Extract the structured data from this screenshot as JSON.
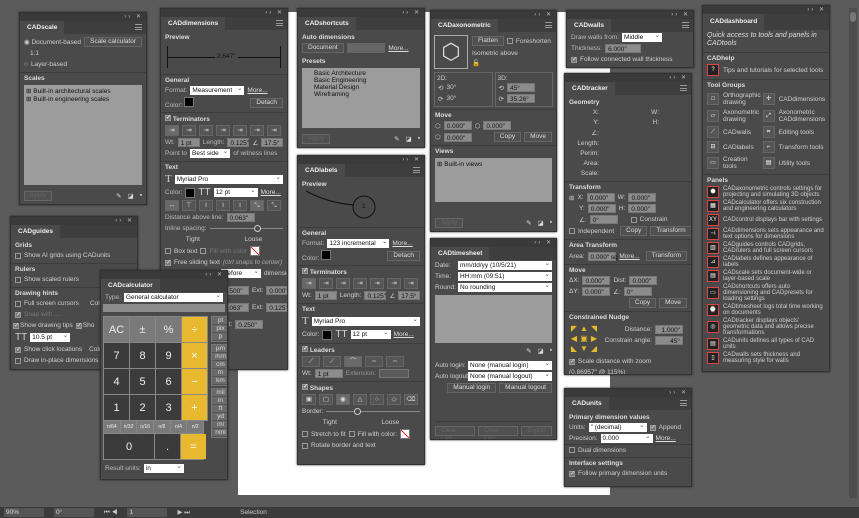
{
  "status": {
    "zoom": "90%",
    "rotation": "0°",
    "artboard": "1",
    "tool": "Selection"
  },
  "cadscale": {
    "title": "CADscale",
    "doc_based": "Document-based",
    "scale_calc": "Scale calculator",
    "ratio": "1:1",
    "layer_based": "Layer-based",
    "scales": "Scales",
    "items": [
      "Built-in architectural scales",
      "Built-in engineering scales"
    ],
    "apply": "Apply"
  },
  "caddim": {
    "title": "CADdimensions",
    "preview": "Preview",
    "preview_value": "2.647\"",
    "general": "General",
    "format_label": "Format:",
    "format": "Measurement",
    "more": "More...",
    "color_label": "Color:",
    "detach": "Detach",
    "terminators": "Terminators",
    "wt_label": "Wt:",
    "wt": "1 pt",
    "length_label": "Length:",
    "length": "0.125\"",
    "angle": "17.5°",
    "point_to": "Point to",
    "point_val": "Best side",
    "witness": "of witness lines",
    "text": "Text",
    "font": "Myriad Pro",
    "size": "12 pt",
    "dist_above": "Distance above line:",
    "dist_val": "0.063\"",
    "inline": "Inline spacing:",
    "tight": "Tight",
    "loose": "Loose",
    "box_text": "Box text",
    "fill_color": "Fill with color",
    "free_sliding": "Free sliding text",
    "ctrl_hint": "(ctrl snaps to center)",
    "before": "Before",
    "dimension": "dimension",
    "v1": "0.500\"",
    "ext1": "0.000\"",
    "v2": "0.063\"",
    "ext2": "0.125\"",
    "ext_label": "Ext:",
    "ext3": "0.250\""
  },
  "cadshortcuts": {
    "title": "CADshortcuts",
    "auto_dim": "Auto dimensions",
    "document": "Document",
    "selection": "Selection",
    "more": "More...",
    "presets": "Presets",
    "items": [
      "Basic Architecture",
      "Basic Engineering",
      "Material Design",
      "Wireframing"
    ],
    "apply": "Apply"
  },
  "cadaxo": {
    "title": "CADaxonometric",
    "flatten": "Flatten",
    "foreshorten": "Foreshorten",
    "iso": "Isometric above",
    "d2": "2D:",
    "d3": "3D:",
    "a1": "30°",
    "a2": "30°",
    "b1": "45°",
    "b2": "35.26°",
    "move": "Move",
    "m1": "0.000\"",
    "m2": "0.000\"",
    "m3": "0.000\"",
    "copy": "Copy",
    "move_btn": "Move",
    "views": "Views",
    "views_item": "Built-in views",
    "apply": "Apply"
  },
  "cadwalls": {
    "title": "CADwalls",
    "draw_from": "Draw walls from:",
    "draw_val": "Middle",
    "thickness_label": "Thickness:",
    "thickness": "6.000\"",
    "follow": "Follow connected wall thickness"
  },
  "cadtracker": {
    "title": "CADtracker",
    "geometry": "Geometry",
    "x": "X:",
    "w": "W:",
    "y": "Y:",
    "h": "H:",
    "length": "Length:",
    "perim": "Perim:",
    "area": "Area:",
    "scale": "Scale:",
    "transform": "Transform",
    "tx": "0.000\"",
    "ty": "0.000\"",
    "tw": "0.000\"",
    "th": "0.000\"",
    "tang": "0°",
    "constrain": "Constrain",
    "independent": "Independent",
    "copy": "Copy",
    "transform_btn": "Transform",
    "area_transform": "Area Transform",
    "area_label": "Area:",
    "area_val": "0.000\" sq",
    "more": "More...",
    "move": "Move",
    "dx": "0.000\"",
    "dy": "0.000\"",
    "dist_label": "Dist:",
    "dist": "0.000\"",
    "mang": "0°",
    "move_btn": "Move",
    "nudge": "Constrained Nudge",
    "distance_label": "Distance:",
    "distance": "1.000\"",
    "cangle_label": "Constrain angle:",
    "cangle": "45°",
    "scale_zoom": "Scale distance with zoom",
    "scale_info": "(0.86957\" @ 115%)"
  },
  "caddash": {
    "title": "CADdashboard",
    "subtitle": "Quick access to tools and panels in CADtools",
    "help": "CADhelp",
    "help_text": "Tips and tutorials for selected tools",
    "tool_groups": "Tool Groups",
    "tools": [
      "Orthographic drawing",
      "CADdimensions",
      "Axonometric drawing",
      "Axonometric CADdimensions",
      "CADwalls",
      "Editing tools",
      "CADlabels",
      "Transform tools",
      "Creation tools",
      "Utility tools"
    ],
    "panels": "Panels",
    "panel_items": [
      "CADaxonometric controls settings for projecting and simulating 3D objects",
      "CADcalculator offers six construction and engineering calculators",
      "CADcontrol displays bar with settings",
      "CADdimensions sets appearance and text options for dimensions",
      "CADguides controls CADgrids, CADrulers and full screen cursors",
      "CADlabels defines appearance of labels",
      "CADscale sets document-wide or layer-based scale",
      "CADshortcuts offers auto dimensioning and CADpresets for loading settings",
      "CADtimesheet logs total time working on documents",
      "CADtracker displays objects' geometric data and allows precise transformations",
      "CADunits defines all types of CAD units",
      "CADwalls sets thickness and measuring style for walls"
    ]
  },
  "cadguides": {
    "title": "CADguides",
    "grids": "Grids",
    "show_grids": "Show AI grids using CADunits",
    "rulers": "Rulers",
    "show_rulers": "Show scaled rulers",
    "hints": "Drawing hints",
    "full_cursors": "Full screen cursors",
    "color": "Color:",
    "snap": "Snap with ...",
    "tips": "Show drawing tips",
    "sho": "Sho",
    "size": "10.5 pt",
    "clicks": "Show click locations",
    "inplace": "Draw in-place dimensions"
  },
  "cadcalc": {
    "title": "CADcalculator",
    "type_label": "Type:",
    "type": "General calculator",
    "keys": [
      "AC",
      "±",
      "%",
      "÷",
      "7",
      "8",
      "9",
      "×",
      "4",
      "5",
      "6",
      "−",
      "1",
      "2",
      "3",
      "+"
    ],
    "fractions": [
      "n/64",
      "n/32",
      "n/16",
      "n/8",
      "n/4",
      "n/2"
    ],
    "zero": "0",
    "dot": ".",
    "equals": "=",
    "units1": [
      "pt",
      "pix",
      "p"
    ],
    "units2": [
      "µm",
      "mm",
      "cm",
      "m",
      "km"
    ],
    "units3": [
      "mil",
      "in",
      "ft",
      "yd",
      "mi",
      "nmi"
    ],
    "result_label": "Result units:",
    "result": "in"
  },
  "cadlabels": {
    "title": "CADlabels",
    "preview": "Preview",
    "preview_num": "1",
    "general": "General",
    "format_label": "Format:",
    "format": "123 incremental",
    "more": "More...",
    "color_label": "Color:",
    "detach": "Detach",
    "terminators": "Terminators",
    "wt_label": "Wt:",
    "wt": "1 pt",
    "length_label": "Length:",
    "length": "0.125\"",
    "angle": "17.5°",
    "text": "Text",
    "font": "Myriad Pro",
    "size": "12 pt",
    "leaders": "Leaders",
    "lwt": "1 pt",
    "extension": "Extension:",
    "shapes": "Shapes",
    "border": "Border:",
    "tight": "Tight",
    "loose": "Loose",
    "stretch": "Stretch to fit",
    "fill": "Fill with color:",
    "rotate": "Rotate border and text"
  },
  "cadtime": {
    "title": "CADtimesheet",
    "date_label": "Date:",
    "date": "mm/dd/yy (10/5/21)",
    "time_label": "Time:",
    "time": "HH:mm (09:51)",
    "round_label": "Round:",
    "round": "No rounding",
    "login_label": "Auto login:",
    "login": "None (manual login)",
    "logout_label": "Auto logout:",
    "logout": "None (manual logout)",
    "manual_login": "Manual login",
    "manual_logout": "Manual logout",
    "b1": "Clear Log",
    "b2": "Clear Log",
    "b3": "Export"
  },
  "cadunits": {
    "title": "CADunits",
    "primary": "Primary dimension values",
    "units_label": "Units:",
    "units": "\" (decimal)",
    "append": "Append",
    "precision_label": "Precision:",
    "precision": "0.000",
    "more": "More...",
    "dual": "Dual dimensions",
    "interface": "Interface settings",
    "follow": "Follow primary dimension units"
  },
  "colors": {
    "background": "#5b5b5b",
    "panel": "#4a4a4a",
    "accent": "#e8b92e",
    "icon_border": "#dd4444"
  }
}
